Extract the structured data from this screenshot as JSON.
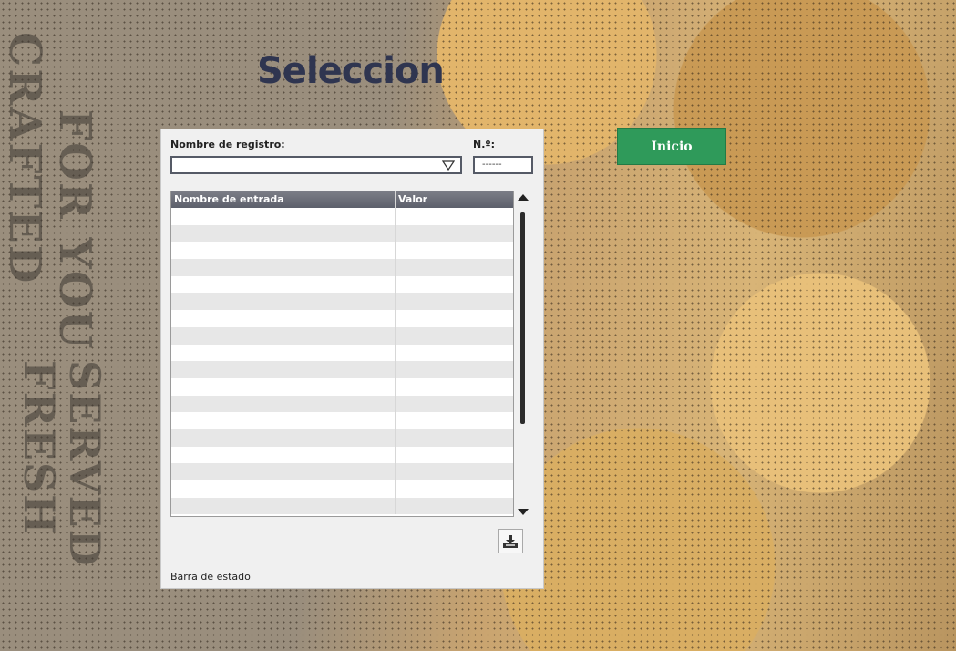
{
  "title": "Seleccion",
  "start_button": "Inicio",
  "panel": {
    "record_name_label": "Nombre de registro:",
    "record_name_value": "",
    "number_label": "N.º:",
    "number_value": "------",
    "columns": [
      "Nombre de entrada",
      "Valor"
    ],
    "rows": 18,
    "status_bar": "Barra de estado"
  },
  "icons": {
    "combo_arrow": "chevron-down-icon",
    "export": "download-icon"
  },
  "colors": {
    "title": "#2f3550",
    "start_button": "#2f9a5a",
    "table_header": "#6b6d78"
  }
}
